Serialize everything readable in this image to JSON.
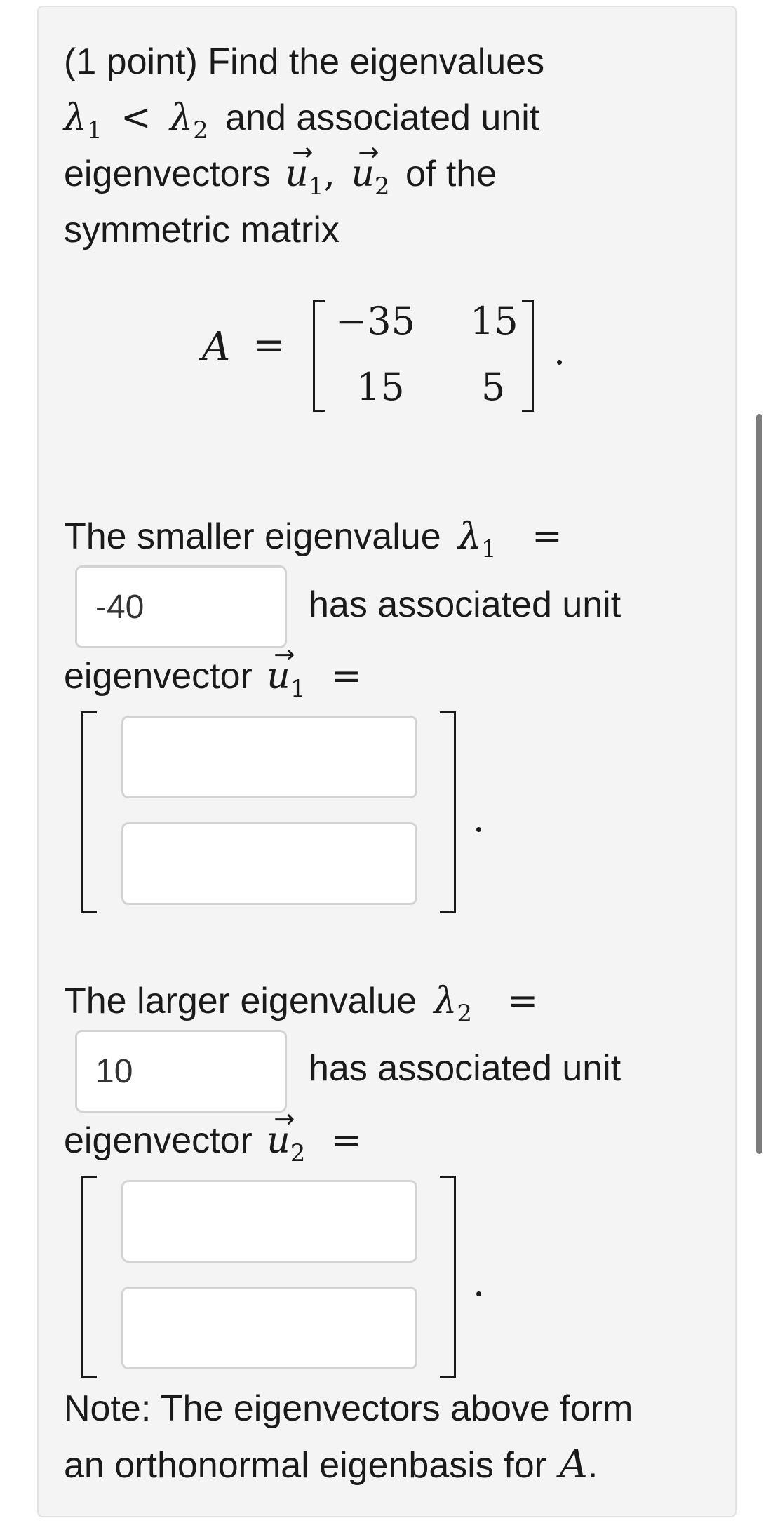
{
  "problem": {
    "intro_line1": "(1 point) Find the eigenvalues",
    "lambda": "λ",
    "sub1": "1",
    "sub2": "2",
    "less_than": "<",
    "and_unit": "and associated unit",
    "eigenvectors_word": "eigenvectors",
    "u": "u",
    "comma": ",",
    "of_the": "of the",
    "intro_line4": "symmetric matrix",
    "equals": "="
  },
  "matrix": {
    "name": "A",
    "a11": "−35",
    "a12": "15",
    "a21": "15",
    "a22": "5",
    "period": "."
  },
  "part1": {
    "label": "The smaller eigenvalue",
    "eigenvalue_input_value": "-40",
    "has_assoc": "has associated unit",
    "eigvec_label": "eigenvector",
    "vec_input1_value": "",
    "vec_input2_value": ""
  },
  "part2": {
    "label": "The larger eigenvalue",
    "eigenvalue_input_value": "10",
    "has_assoc": "has associated unit",
    "eigvec_label": "eigenvector",
    "vec_input1_value": "",
    "vec_input2_value": ""
  },
  "note": {
    "line1": "Note: The eigenvectors above form",
    "line2_prefix": "an orthonormal eigenbasis for",
    "matrix_name": "A",
    "end_period": "."
  },
  "colors": {
    "card_bg": "#f4f4f4",
    "input_border": "#d3d3d3",
    "scrollbar": "#7b7b7b"
  }
}
